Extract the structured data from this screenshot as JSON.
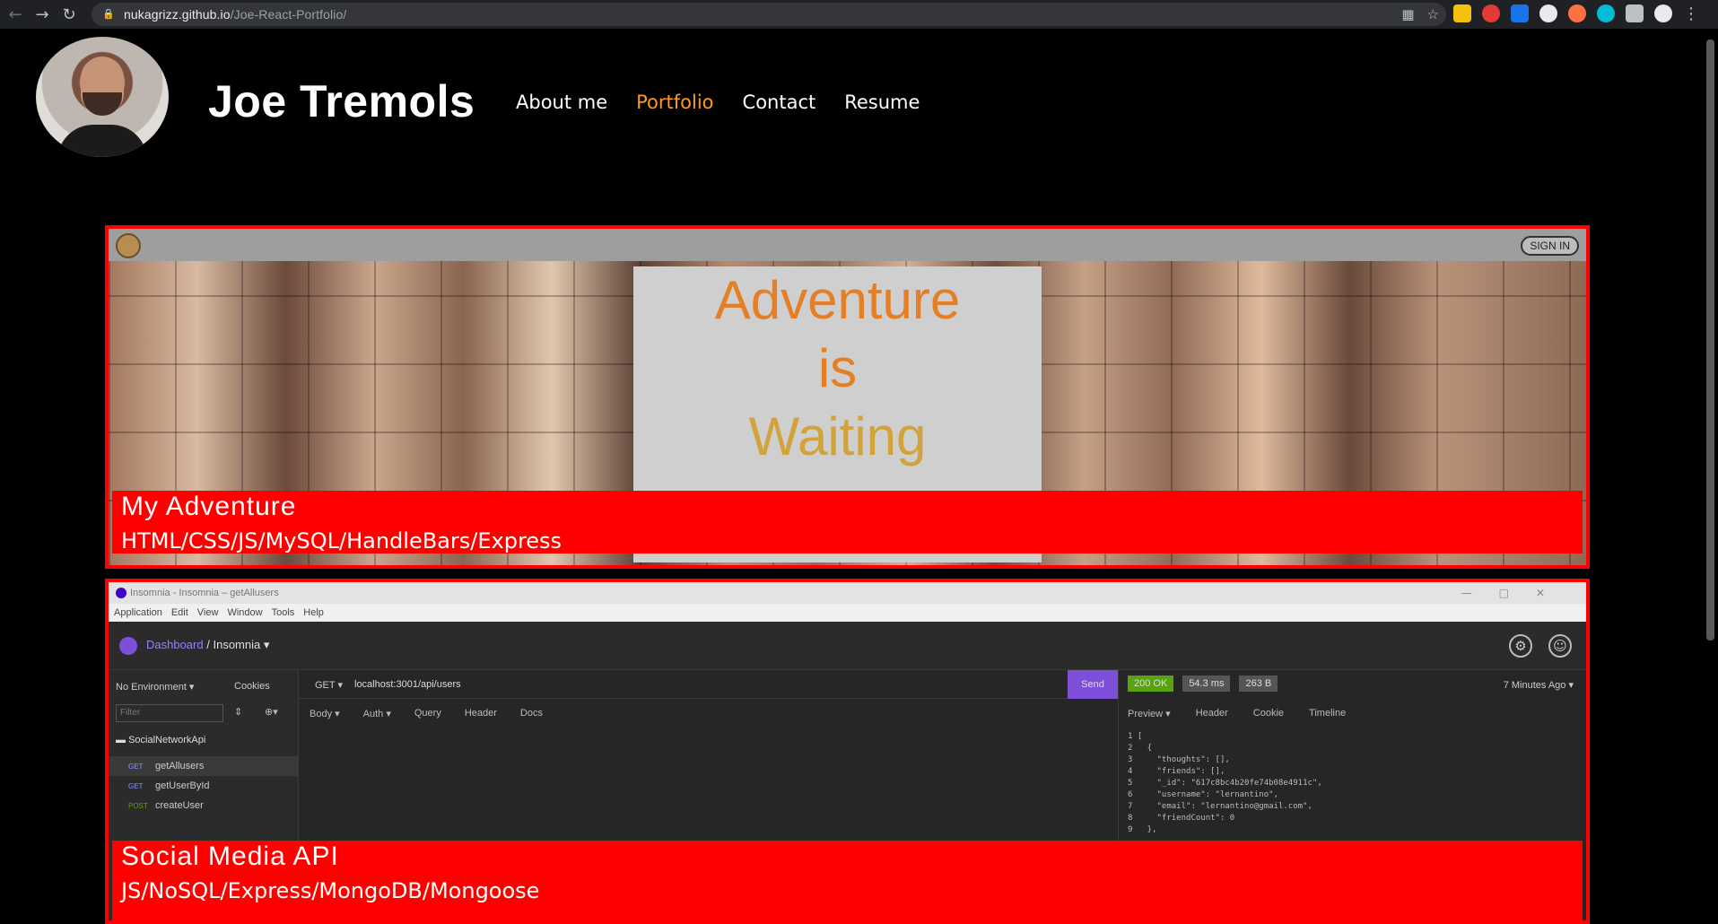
{
  "browser": {
    "url_host": "nukagrizz.github.io",
    "url_path": "/Joe-React-Portfolio/"
  },
  "icons": [
    "back-arrow-icon",
    "forward-arrow-icon",
    "reload-icon",
    "lock-icon",
    "qr-code-icon",
    "bookmark-star-icon",
    "extensions-icon",
    "profile-icon",
    "menu-icon"
  ],
  "site": {
    "title": "Joe Tremols",
    "nav": [
      {
        "label": "About me",
        "active": false
      },
      {
        "label": "Portfolio",
        "active": true
      },
      {
        "label": "Contact",
        "active": false
      },
      {
        "label": "Resume",
        "active": false
      }
    ],
    "accent_color": "#ff9a1f",
    "card_color": "#ff0000"
  },
  "projects": [
    {
      "title": "My Adventure",
      "tech": "HTML/CSS/JS/MySQL/HandleBars/Express",
      "preview": {
        "signin": "SIGN IN",
        "lines": [
          "Adventure",
          "is",
          "Waiting"
        ]
      }
    },
    {
      "title": "Social Media API",
      "tech": "JS/NoSQL/Express/MongoDB/Mongoose",
      "preview": {
        "window_title": "Insomnia - Insomnia – getAllusers",
        "menu": [
          "Application",
          "Edit",
          "View",
          "Window",
          "Tools",
          "Help"
        ],
        "breadcrumb_root": "Dashboard",
        "breadcrumb_sep": "/",
        "breadcrumb_current": "Insomnia ▾",
        "environment": "No Environment ▾",
        "cookies": "Cookies",
        "filter": "Filter",
        "folder": "SocialNetworkApi",
        "requests": [
          {
            "method": "GET",
            "name": "getAllusers"
          },
          {
            "method": "GET",
            "name": "getUserById"
          },
          {
            "method": "POST",
            "name": "createUser"
          }
        ],
        "method": "GET ▾",
        "url": "localhost:3001/api/users",
        "send": "Send",
        "tabs": [
          "Body ▾",
          "Auth ▾",
          "Query",
          "Header",
          "Docs"
        ],
        "status": "200 OK",
        "time": "54.3 ms",
        "size": "263 B",
        "ago": "7 Minutes Ago ▾",
        "resp_tabs": [
          "Preview ▾",
          "Header",
          "Cookie",
          "Timeline"
        ],
        "code": "1 [\n2   {\n3     \"thoughts\": [],\n4     \"friends\": [],\n5     \"_id\": \"617c8bc4b20fe74b08e4911c\",\n6     \"username\": \"lernantino\",\n7     \"email\": \"lernantino@gmail.com\",\n8     \"friendCount\": 0\n9   },"
      }
    }
  ]
}
